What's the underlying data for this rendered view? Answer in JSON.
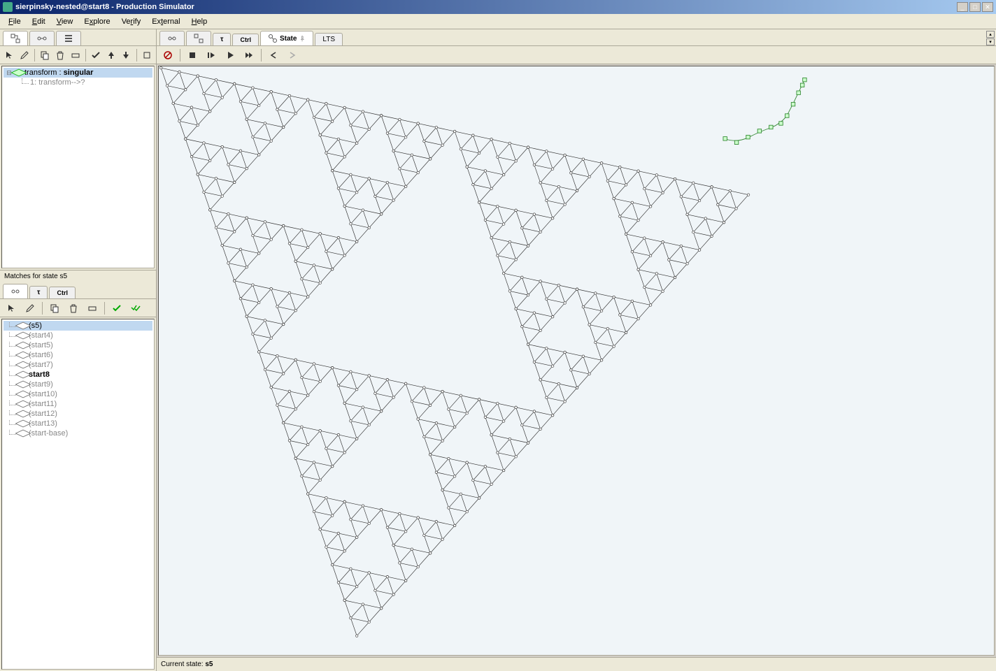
{
  "window": {
    "title": "sierpinsky-nested@start8 - Production Simulator"
  },
  "menu": {
    "file": "File",
    "edit": "Edit",
    "view": "View",
    "explore": "Explore",
    "verify": "Verify",
    "external": "External",
    "help": "Help"
  },
  "left_top": {
    "tree_root": "transform :",
    "tree_root_suffix": "singular",
    "tree_child": "1: transform-->?"
  },
  "left_mid_label": "Matches for state s5",
  "left_bottom": {
    "items": [
      {
        "label": "(s5)",
        "selected": true,
        "bold": false,
        "gray": false
      },
      {
        "label": "(start4)",
        "selected": false,
        "bold": false,
        "gray": true
      },
      {
        "label": "(start5)",
        "selected": false,
        "bold": false,
        "gray": true
      },
      {
        "label": "(start6)",
        "selected": false,
        "bold": false,
        "gray": true
      },
      {
        "label": "(start7)",
        "selected": false,
        "bold": false,
        "gray": true
      },
      {
        "label": "start8",
        "selected": false,
        "bold": true,
        "gray": false
      },
      {
        "label": "(start9)",
        "selected": false,
        "bold": false,
        "gray": true
      },
      {
        "label": "(start10)",
        "selected": false,
        "bold": false,
        "gray": true
      },
      {
        "label": "(start11)",
        "selected": false,
        "bold": false,
        "gray": true
      },
      {
        "label": "(start12)",
        "selected": false,
        "bold": false,
        "gray": true
      },
      {
        "label": "(start13)",
        "selected": false,
        "bold": false,
        "gray": true
      },
      {
        "label": "(start-base)",
        "selected": false,
        "bold": false,
        "gray": true
      }
    ]
  },
  "right_tabs": {
    "tab4_label": "State",
    "tab5_label": "LTS"
  },
  "status": {
    "label": "Current state:",
    "value": "s5"
  }
}
